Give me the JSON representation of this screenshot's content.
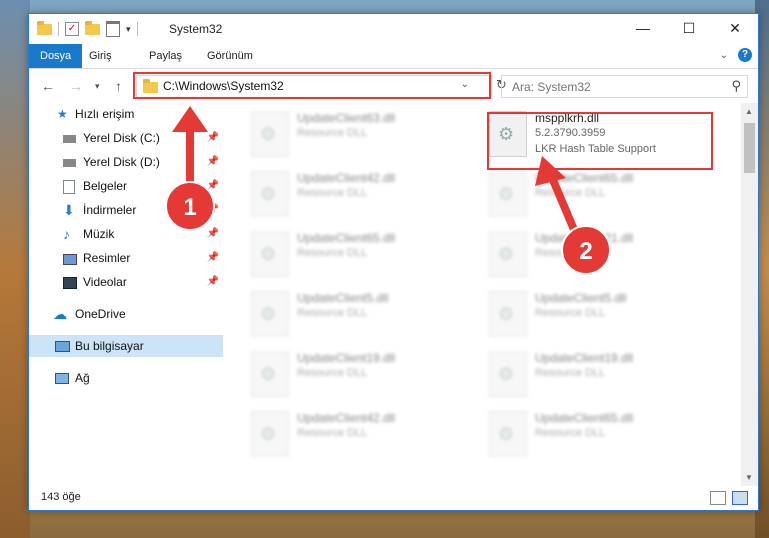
{
  "window": {
    "title": "System32",
    "controls": {
      "minimize": "—",
      "maximize": "☐",
      "close": "✕"
    }
  },
  "ribbon": {
    "tabs": [
      "Dosya",
      "Giriş",
      "Paylaş",
      "Görünüm"
    ],
    "help": "?"
  },
  "navigation": {
    "address": "C:\\Windows\\System32",
    "search_placeholder": "Ara: System32"
  },
  "sidebar": {
    "items": [
      {
        "label": "Hızlı erişim",
        "icon": "star-icon"
      },
      {
        "label": "Yerel Disk (C:)",
        "icon": "drive-icon"
      },
      {
        "label": "Yerel Disk (D:)",
        "icon": "drive-icon"
      },
      {
        "label": "Belgeler",
        "icon": "document-icon"
      },
      {
        "label": "İndirmeler",
        "icon": "download-icon"
      },
      {
        "label": "Müzik",
        "icon": "music-icon"
      },
      {
        "label": "Resimler",
        "icon": "pictures-icon"
      },
      {
        "label": "Videolar",
        "icon": "video-icon"
      },
      {
        "label": "OneDrive",
        "icon": "cloud-icon"
      },
      {
        "label": "Bu bilgisayar",
        "icon": "computer-icon"
      },
      {
        "label": "Ağ",
        "icon": "network-icon"
      }
    ]
  },
  "files": {
    "highlighted": {
      "name": "mspplkrh.dll",
      "version": "5.2.3790.3959",
      "description": "LKR Hash Table Support"
    },
    "left_column": [
      {
        "name": "UpdateClient63.dll",
        "desc": "Resource DLL"
      },
      {
        "name": "UpdateClient42.dll",
        "desc": "Resource DLL"
      },
      {
        "name": "UpdateClient65.dll",
        "desc": "Resource DLL"
      },
      {
        "name": "UpdateClient5.dll",
        "desc": "Resource DLL"
      },
      {
        "name": "UpdateClient19.dll",
        "desc": "Resource DLL"
      },
      {
        "name": "UpdateClient42.dll",
        "desc": "Resource DLL"
      }
    ],
    "right_column": [
      {
        "name": "UpdateClient65.dll",
        "desc": "Resource DLL"
      },
      {
        "name": "UpdateClient21.dll",
        "desc": "Resource DLL"
      },
      {
        "name": "UpdateClient5.dll",
        "desc": "Resource DLL"
      },
      {
        "name": "UpdateClient19.dll",
        "desc": "Resource DLL"
      },
      {
        "name": "UpdateClient65.dll",
        "desc": "Resource DLL"
      }
    ]
  },
  "status": {
    "count": "143 öğe"
  },
  "annotations": [
    {
      "number": "1",
      "color": "#e53935"
    },
    {
      "number": "2",
      "color": "#e53935"
    }
  ]
}
